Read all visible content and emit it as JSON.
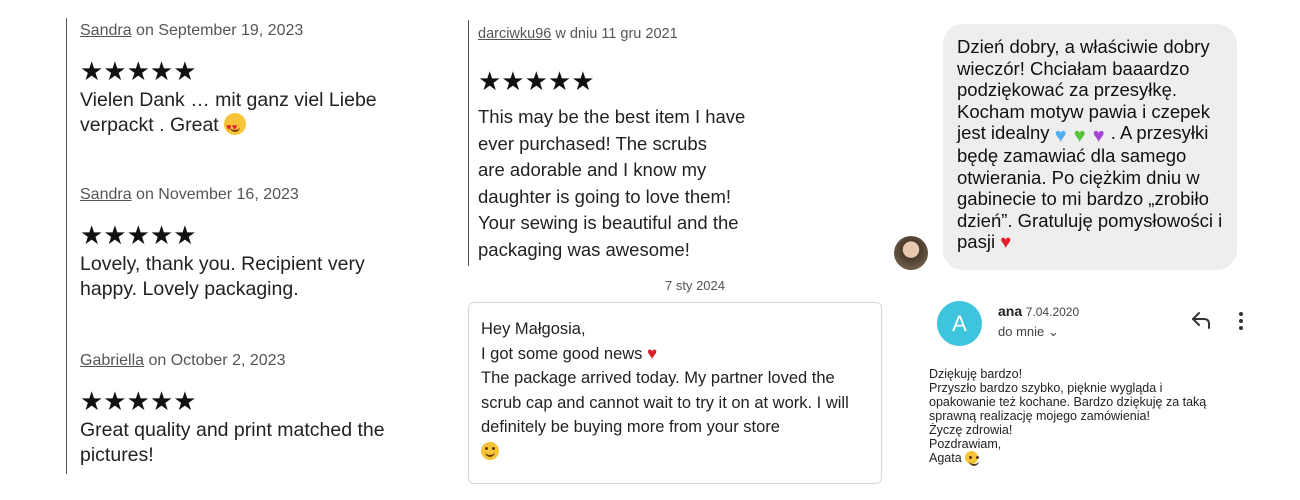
{
  "reviews": [
    {
      "user": "Sandra",
      "meta": " on September 19, 2023",
      "stars": "★★★★★",
      "text": "Vielen Dank … mit ganz viel Liebe verpackt . Great"
    },
    {
      "user": "Sandra",
      "meta": " on November 16, 2023",
      "stars": "★★★★★",
      "text": "Lovely, thank you. Recipient very happy. Lovely packaging."
    },
    {
      "user": "Gabriella",
      "meta": " on October 2, 2023",
      "stars": "★★★★★",
      "text": "Great quality and print matched the pictures!"
    }
  ],
  "polish_review": {
    "user": "darciwku96",
    "meta": " w dniu 11 gru 2021",
    "stars": "★★★★★",
    "lines": [
      "This may be the best item I have",
      "ever purchased! The scrubs",
      "are adorable and I know my",
      "daughter is going to love them!",
      "Your sewing is beautiful and the",
      "packaging was awesome!"
    ]
  },
  "message": {
    "date": "7 sty 2024",
    "greeting": "Hey Małgosia,",
    "line2": "I got some good news",
    "line3": "The package arrived today. My partner loved the scrub cap and cannot wait to try it on at work. I will definitely be buying more from your store"
  },
  "chat": {
    "part1": "Dzień dobry, a właściwie dobry wieczór! Chciałam baaardzo podziękować za przesyłkę. Kocham motyw pawia i czepek jest idealny",
    "part2": ". A przesyłki będę zamawiać dla samego otwierania. Po ciężkim dniu w gabinecie to mi bardzo „zrobiło dzień”. Gratuluję pomysłowości i pasji",
    "hearts": [
      "♥",
      "♥",
      "♥"
    ],
    "heart_colors": [
      "#55aef0",
      "#55c43a",
      "#a347d4"
    ]
  },
  "email": {
    "avatar_letter": "A",
    "sender": "ana",
    "date": "7.04.2020",
    "recipient": "do mnie ⌄",
    "body": [
      "Dziękuję bardzo!",
      "Przyszło bardzo szybko, pięknie wygląda i",
      "opakowanie też kochane. Bardzo dziękuję za taką",
      "sprawną realizację mojego zamówienia!",
      "Życzę zdrowia!",
      "Pozdrawiam,",
      "Agata"
    ],
    "accent_color": "#3ec4dd"
  }
}
